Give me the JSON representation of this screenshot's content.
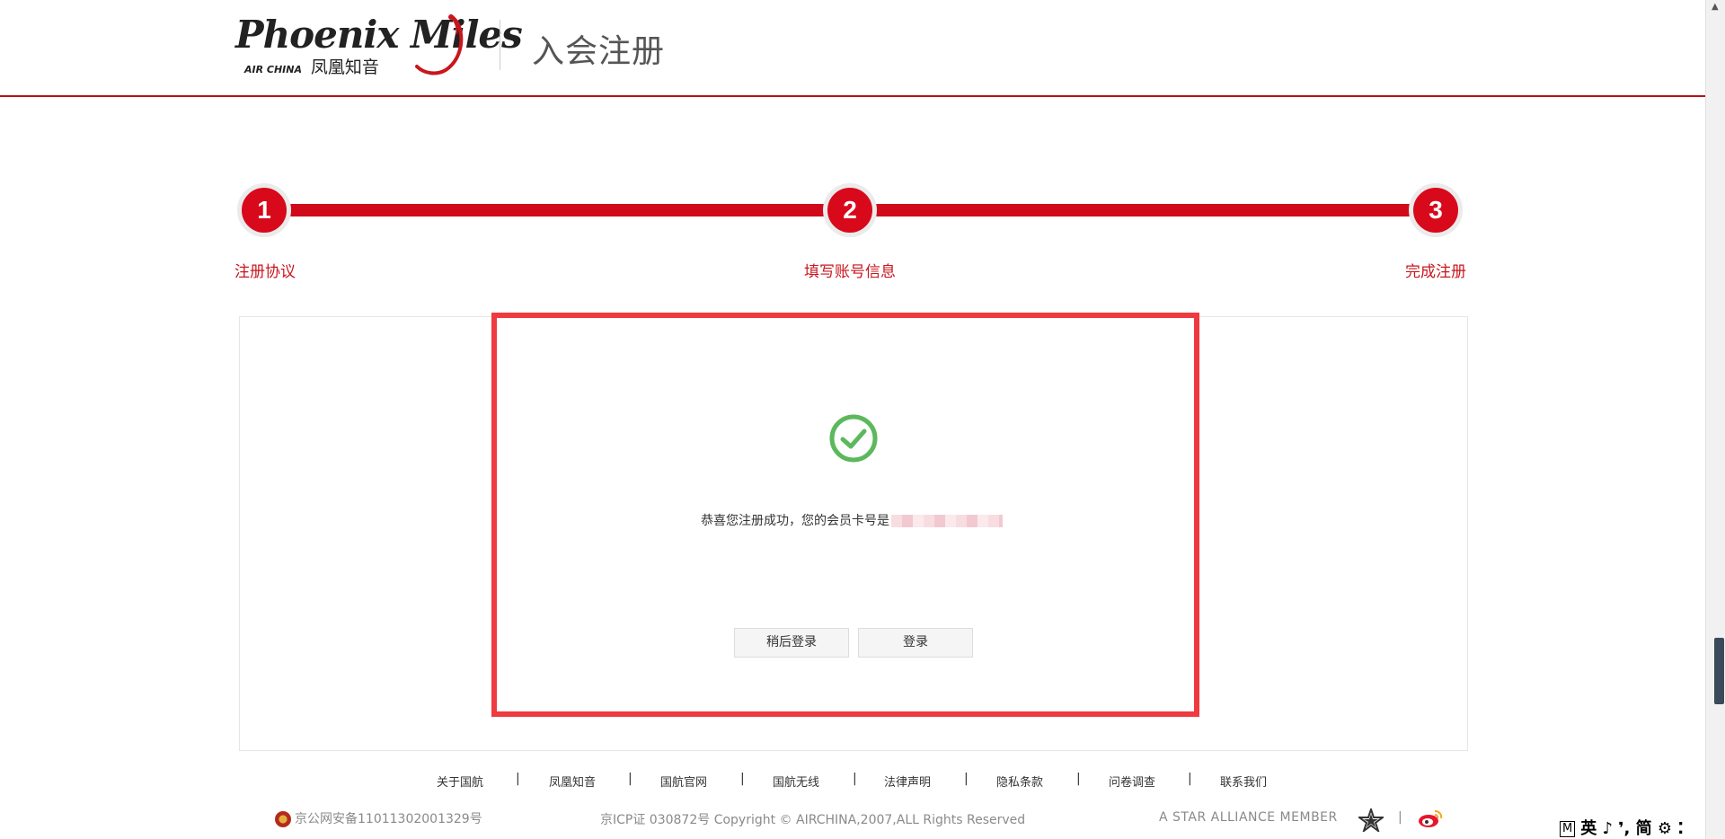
{
  "header": {
    "logo_script": "Phoenix Miles",
    "logo_airline": "AIR CHINA",
    "logo_cn": "凤凰知音",
    "title": "入会注册"
  },
  "steps": [
    {
      "number": "1",
      "label": "注册协议"
    },
    {
      "number": "2",
      "label": "填写账号信息"
    },
    {
      "number": "3",
      "label": "完成注册"
    }
  ],
  "main": {
    "success_icon": "check-circle-icon",
    "success_message": "恭喜您注册成功，您的会员卡号是",
    "buttons": {
      "later_login": "稍后登录",
      "login": "登录"
    }
  },
  "footer": {
    "links": [
      "关于国航",
      "凤凰知音",
      "国航官网",
      "国航无线",
      "法律声明",
      "隐私条款",
      "问卷调查",
      "联系我们"
    ],
    "separator": "|",
    "police_record": "京公网安备11011302001329号",
    "copyright": "京ICP证 030872号 Copyright © AIRCHINA,2007,ALL Rights Reserved",
    "star_alliance": "A STAR ALLIANCE MEMBER",
    "icons": [
      "star-alliance-icon",
      "weibo-icon"
    ]
  },
  "ime": {
    "mode_box": "M",
    "text": "英 ♪ ❜, 简 ⚙ ⁚"
  },
  "colors": {
    "brand_red": "#d0091b",
    "label_red": "#c8161d",
    "highlight_red": "#ef3a3f",
    "success_green": "#5cb85c"
  }
}
